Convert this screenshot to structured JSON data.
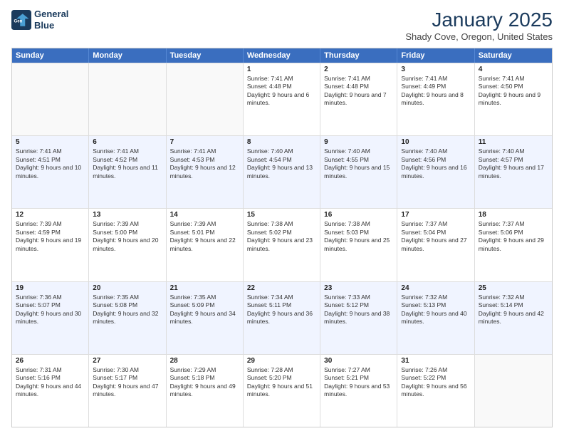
{
  "header": {
    "title": "January 2025",
    "subtitle": "Shady Cove, Oregon, United States",
    "logo_line1": "General",
    "logo_line2": "Blue"
  },
  "days_of_week": [
    "Sunday",
    "Monday",
    "Tuesday",
    "Wednesday",
    "Thursday",
    "Friday",
    "Saturday"
  ],
  "rows": [
    [
      {
        "day": "",
        "text": ""
      },
      {
        "day": "",
        "text": ""
      },
      {
        "day": "",
        "text": ""
      },
      {
        "day": "1",
        "text": "Sunrise: 7:41 AM\nSunset: 4:48 PM\nDaylight: 9 hours and 6 minutes."
      },
      {
        "day": "2",
        "text": "Sunrise: 7:41 AM\nSunset: 4:48 PM\nDaylight: 9 hours and 7 minutes."
      },
      {
        "day": "3",
        "text": "Sunrise: 7:41 AM\nSunset: 4:49 PM\nDaylight: 9 hours and 8 minutes."
      },
      {
        "day": "4",
        "text": "Sunrise: 7:41 AM\nSunset: 4:50 PM\nDaylight: 9 hours and 9 minutes."
      }
    ],
    [
      {
        "day": "5",
        "text": "Sunrise: 7:41 AM\nSunset: 4:51 PM\nDaylight: 9 hours and 10 minutes."
      },
      {
        "day": "6",
        "text": "Sunrise: 7:41 AM\nSunset: 4:52 PM\nDaylight: 9 hours and 11 minutes."
      },
      {
        "day": "7",
        "text": "Sunrise: 7:41 AM\nSunset: 4:53 PM\nDaylight: 9 hours and 12 minutes."
      },
      {
        "day": "8",
        "text": "Sunrise: 7:40 AM\nSunset: 4:54 PM\nDaylight: 9 hours and 13 minutes."
      },
      {
        "day": "9",
        "text": "Sunrise: 7:40 AM\nSunset: 4:55 PM\nDaylight: 9 hours and 15 minutes."
      },
      {
        "day": "10",
        "text": "Sunrise: 7:40 AM\nSunset: 4:56 PM\nDaylight: 9 hours and 16 minutes."
      },
      {
        "day": "11",
        "text": "Sunrise: 7:40 AM\nSunset: 4:57 PM\nDaylight: 9 hours and 17 minutes."
      }
    ],
    [
      {
        "day": "12",
        "text": "Sunrise: 7:39 AM\nSunset: 4:59 PM\nDaylight: 9 hours and 19 minutes."
      },
      {
        "day": "13",
        "text": "Sunrise: 7:39 AM\nSunset: 5:00 PM\nDaylight: 9 hours and 20 minutes."
      },
      {
        "day": "14",
        "text": "Sunrise: 7:39 AM\nSunset: 5:01 PM\nDaylight: 9 hours and 22 minutes."
      },
      {
        "day": "15",
        "text": "Sunrise: 7:38 AM\nSunset: 5:02 PM\nDaylight: 9 hours and 23 minutes."
      },
      {
        "day": "16",
        "text": "Sunrise: 7:38 AM\nSunset: 5:03 PM\nDaylight: 9 hours and 25 minutes."
      },
      {
        "day": "17",
        "text": "Sunrise: 7:37 AM\nSunset: 5:04 PM\nDaylight: 9 hours and 27 minutes."
      },
      {
        "day": "18",
        "text": "Sunrise: 7:37 AM\nSunset: 5:06 PM\nDaylight: 9 hours and 29 minutes."
      }
    ],
    [
      {
        "day": "19",
        "text": "Sunrise: 7:36 AM\nSunset: 5:07 PM\nDaylight: 9 hours and 30 minutes."
      },
      {
        "day": "20",
        "text": "Sunrise: 7:35 AM\nSunset: 5:08 PM\nDaylight: 9 hours and 32 minutes."
      },
      {
        "day": "21",
        "text": "Sunrise: 7:35 AM\nSunset: 5:09 PM\nDaylight: 9 hours and 34 minutes."
      },
      {
        "day": "22",
        "text": "Sunrise: 7:34 AM\nSunset: 5:11 PM\nDaylight: 9 hours and 36 minutes."
      },
      {
        "day": "23",
        "text": "Sunrise: 7:33 AM\nSunset: 5:12 PM\nDaylight: 9 hours and 38 minutes."
      },
      {
        "day": "24",
        "text": "Sunrise: 7:32 AM\nSunset: 5:13 PM\nDaylight: 9 hours and 40 minutes."
      },
      {
        "day": "25",
        "text": "Sunrise: 7:32 AM\nSunset: 5:14 PM\nDaylight: 9 hours and 42 minutes."
      }
    ],
    [
      {
        "day": "26",
        "text": "Sunrise: 7:31 AM\nSunset: 5:16 PM\nDaylight: 9 hours and 44 minutes."
      },
      {
        "day": "27",
        "text": "Sunrise: 7:30 AM\nSunset: 5:17 PM\nDaylight: 9 hours and 47 minutes."
      },
      {
        "day": "28",
        "text": "Sunrise: 7:29 AM\nSunset: 5:18 PM\nDaylight: 9 hours and 49 minutes."
      },
      {
        "day": "29",
        "text": "Sunrise: 7:28 AM\nSunset: 5:20 PM\nDaylight: 9 hours and 51 minutes."
      },
      {
        "day": "30",
        "text": "Sunrise: 7:27 AM\nSunset: 5:21 PM\nDaylight: 9 hours and 53 minutes."
      },
      {
        "day": "31",
        "text": "Sunrise: 7:26 AM\nSunset: 5:22 PM\nDaylight: 9 hours and 56 minutes."
      },
      {
        "day": "",
        "text": ""
      }
    ]
  ],
  "alt_rows": [
    1,
    3
  ]
}
